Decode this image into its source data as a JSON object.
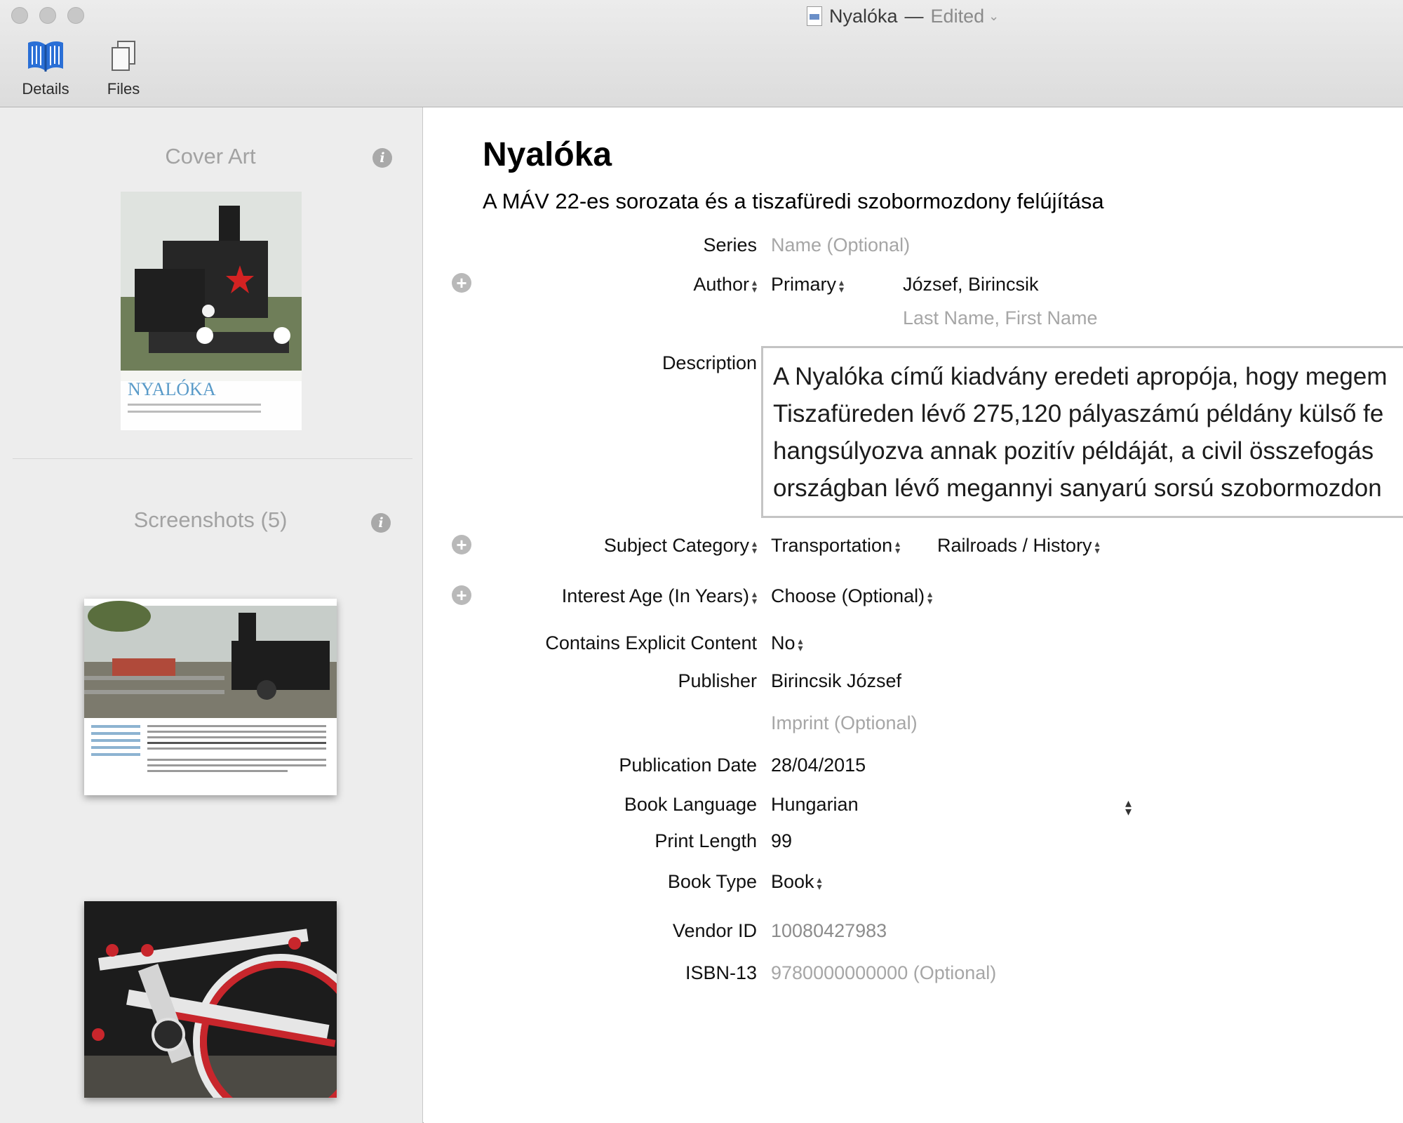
{
  "window": {
    "title": "Nyalóka",
    "dash": "—",
    "status": "Edited"
  },
  "toolbar": {
    "details_label": "Details",
    "files_label": "Files"
  },
  "sidebar": {
    "cover_art_title": "Cover Art",
    "cover": {
      "title": "NYALÓKA"
    },
    "screenshots_title": "Screenshots (5)"
  },
  "book": {
    "title": "Nyalóka",
    "subtitle": "A MÁV 22-es sorozata és a tiszafüredi szobormozdony felújítása"
  },
  "fields": {
    "series_label": "Series",
    "series_placeholder": "Name (Optional)",
    "author_label": "Author",
    "author_role": "Primary",
    "author_name": "József, Birincsik",
    "author_hint": "Last Name, First Name",
    "description_label": "Description",
    "description_lines": [
      "A Nyalóka című kiadvány eredeti apropója, hogy megem",
      "Tiszafüreden lévő 275,120 pályaszámú példány külső fe",
      "hangsúlyozva annak pozitív példáját, a civil összefogás",
      "országban lévő megannyi sanyarú sorsú szobormozdon"
    ],
    "subject_label": "Subject Category",
    "subject_primary": "Transportation",
    "subject_secondary": "Railroads / History",
    "interest_label": "Interest Age (In Years)",
    "interest_value": "Choose (Optional)",
    "explicit_label": "Contains Explicit Content",
    "explicit_value": "No",
    "publisher_label": "Publisher",
    "publisher_value": "Birincsik József",
    "imprint_placeholder": "Imprint (Optional)",
    "pubdate_label": "Publication Date",
    "pubdate_value": "28/04/2015",
    "language_label": "Book Language",
    "language_value": "Hungarian",
    "print_length_label": "Print Length",
    "print_length_value": "99",
    "book_type_label": "Book Type",
    "book_type_value": "Book",
    "vendor_label": "Vendor ID",
    "vendor_value": "10080427983",
    "isbn_label": "ISBN-13",
    "isbn_placeholder": "9780000000000 (Optional)"
  },
  "colors": {
    "accent_blue": "#2a6fd6",
    "cover_title": "#5a9bc9",
    "wheel_red": "#c8262c"
  }
}
